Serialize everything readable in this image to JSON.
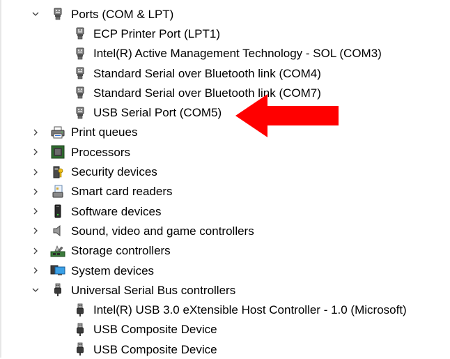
{
  "tree": {
    "ports": {
      "label": "Ports (COM & LPT)",
      "expanded": true,
      "icon": "port-icon",
      "children": [
        {
          "label": "ECP Printer Port (LPT1)",
          "icon": "port-icon"
        },
        {
          "label": "Intel(R) Active Management Technology - SOL (COM3)",
          "icon": "port-icon"
        },
        {
          "label": "Standard Serial over Bluetooth link (COM4)",
          "icon": "port-icon"
        },
        {
          "label": "Standard Serial over Bluetooth link (COM7)",
          "icon": "port-icon"
        },
        {
          "label": "USB Serial Port (COM5)",
          "icon": "port-icon"
        }
      ]
    },
    "categories": [
      {
        "label": "Print queues",
        "icon": "printer-icon",
        "expanded": false
      },
      {
        "label": "Processors",
        "icon": "processor-icon",
        "expanded": false
      },
      {
        "label": "Security devices",
        "icon": "security-key-icon",
        "expanded": false
      },
      {
        "label": "Smart card readers",
        "icon": "smart-card-reader-icon",
        "expanded": false
      },
      {
        "label": "Software devices",
        "icon": "software-device-icon",
        "expanded": false
      },
      {
        "label": "Sound, video and game controllers",
        "icon": "speaker-icon",
        "expanded": false
      },
      {
        "label": "Storage controllers",
        "icon": "storage-controller-icon",
        "expanded": false
      },
      {
        "label": "System devices",
        "icon": "monitor-icon",
        "expanded": false
      }
    ],
    "usb": {
      "label": "Universal Serial Bus controllers",
      "expanded": true,
      "icon": "usb-plug-icon",
      "children": [
        {
          "label": "Intel(R) USB 3.0 eXtensible Host Controller - 1.0 (Microsoft)",
          "icon": "usb-plug-icon"
        },
        {
          "label": "USB Composite Device",
          "icon": "usb-plug-icon"
        },
        {
          "label": "USB Composite Device",
          "icon": "usb-plug-icon"
        }
      ]
    }
  },
  "annotation": {
    "icon": "red-arrow-icon",
    "color": "#ff0000"
  }
}
